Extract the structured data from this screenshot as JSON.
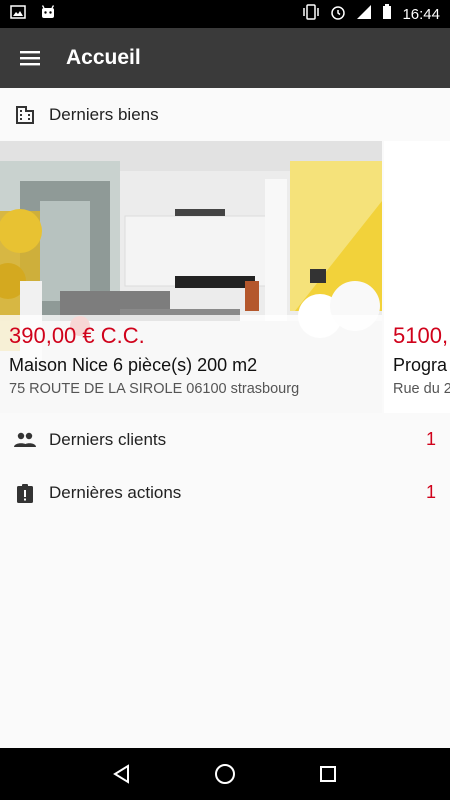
{
  "status_bar": {
    "time": "16:44",
    "left_icons": [
      "image-icon",
      "android-icon"
    ],
    "right_icons": [
      "vibrate-icon",
      "alarm-icon",
      "signal-icon",
      "battery-icon"
    ]
  },
  "app_bar": {
    "title": "Accueil",
    "menu_icon": "hamburger-icon"
  },
  "sections": {
    "latest_properties": {
      "label": "Derniers biens",
      "icon": "building-icon"
    },
    "latest_clients": {
      "label": "Derniers clients",
      "icon": "people-icon",
      "count": "1"
    },
    "latest_actions": {
      "label": "Dernières actions",
      "icon": "clipboard-alert-icon",
      "count": "1"
    }
  },
  "properties": [
    {
      "price": "390,00 € C.C.",
      "title": "Maison Nice 6 pièce(s) 200 m2",
      "address": "75 ROUTE DE LA SIROLE 06100 strasbourg"
    },
    {
      "price": "5100,",
      "title": "Progra",
      "address": "Rue du 2"
    }
  ],
  "nav_bar": {
    "icons": [
      "back-icon",
      "home-icon",
      "recents-icon"
    ]
  },
  "colors": {
    "accent": "#d0021b",
    "app_bar": "#3a3a3a"
  }
}
